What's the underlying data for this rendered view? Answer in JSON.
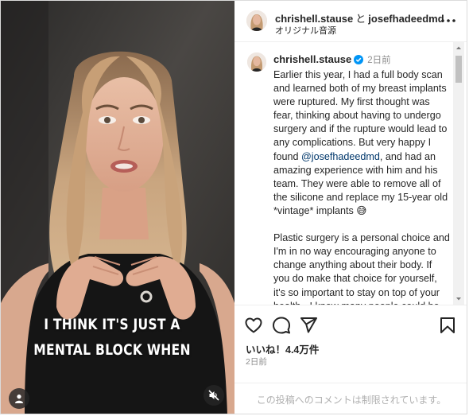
{
  "header": {
    "user1": "chrishell.stause",
    "conjunction": "と",
    "user2": "josefhadeedmd",
    "audio": "オリジナル音源"
  },
  "caption_post": {
    "username": "chrishell.stause",
    "time": "2日前",
    "text_before_mention": "Earlier this year, I had a full body scan and learned both of my breast implants were ruptured. My first thought was fear, thinking about having to undergo surgery and if the rupture would lead to any complications. But very happy I found ",
    "mention": "@josefhadeedmd",
    "text_after_mention": ", and had an amazing experience with him and his team. They were able to remove all of the silicone and replace my 15-year old *vintage* implants 😅\n\nPlastic surgery is a personal choice and I'm in no way encouraging anyone to change anything about their body. If you do make that choice for yourself, it's so important to stay on top of your health - I know many people could be living with this and have no idea."
  },
  "video": {
    "caption_line1": "I THINK IT'S JUST A",
    "caption_line2": "MENTAL BLOCK WHEN"
  },
  "actions": {
    "likes": "いいね！4.4万件",
    "time": "2日前"
  },
  "comment_bar": {
    "disabled_text": "この投稿へのコメントは制限されています。"
  },
  "icons": {
    "like": "heart-icon",
    "comment": "comment-bubble-icon",
    "share": "paper-plane-icon",
    "save": "bookmark-icon",
    "more": "more-dots-icon",
    "user": "user-icon",
    "mute": "speaker-muted-icon",
    "verified": "verified-badge-icon"
  },
  "colors": {
    "verified": "#0095f6",
    "mention": "#00376b",
    "muted_text": "#8e8e8e"
  }
}
